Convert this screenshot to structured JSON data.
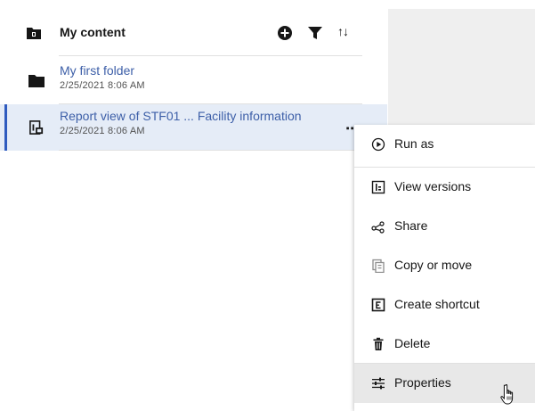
{
  "header": {
    "title": "My content",
    "icons": [
      "folder-icon",
      "add-icon",
      "filter-icon",
      "sort-icon"
    ],
    "sort_glyph": "↑↓"
  },
  "items": [
    {
      "name": "My first folder",
      "date": "2/25/2021 8:06 AM",
      "icon": "folder-icon",
      "selected": false
    },
    {
      "name": "Report view of STF01 ... Facility information",
      "date": "2/25/2021 8:06 AM",
      "icon": "report-view-icon",
      "selected": true,
      "overflow_glyph": "⋯"
    }
  ],
  "context_menu": {
    "items": [
      {
        "label": "Run as",
        "icon": "play-circle-icon"
      },
      {
        "label": "View versions",
        "icon": "versions-icon"
      },
      {
        "label": "Share",
        "icon": "share-icon"
      },
      {
        "label": "Copy or move",
        "icon": "copy-icon"
      },
      {
        "label": "Create shortcut",
        "icon": "shortcut-icon"
      },
      {
        "label": "Delete",
        "icon": "trash-icon"
      },
      {
        "label": "Properties",
        "icon": "sliders-icon",
        "hover": true
      }
    ]
  },
  "colors": {
    "accent": "#2f5bbf",
    "link": "#3d5fa8",
    "selected_row": "#e5ecf7",
    "panel": "#efefef",
    "menu_hover": "#e8e8e8"
  }
}
